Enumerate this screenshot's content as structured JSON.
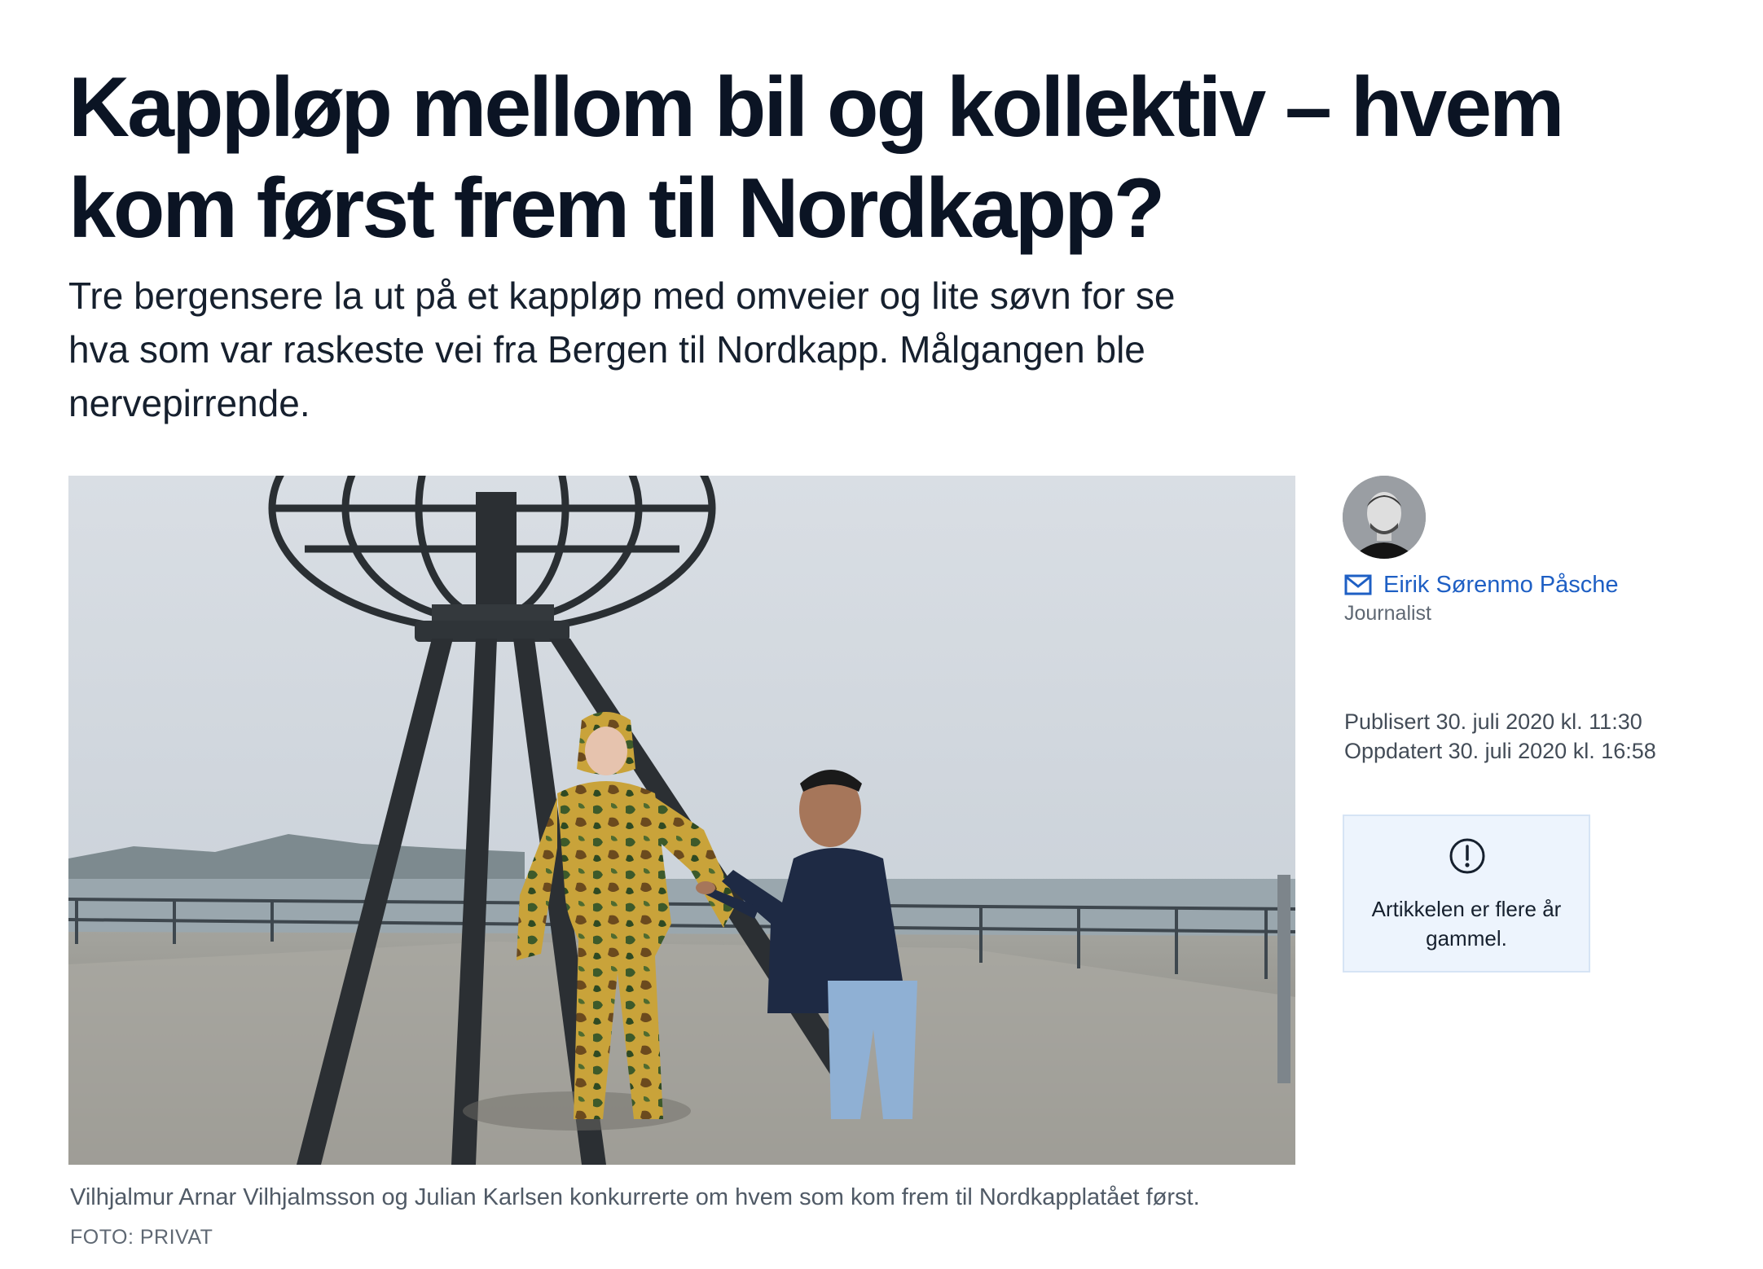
{
  "article": {
    "headline": "Kappløp mellom bil og kollektiv – hvem kom først frem til Nordkapp?",
    "lead": "Tre bergensere la ut på et kappløp med omveier og lite søvn for se hva som var raskeste vei fra Bergen til Nordkapp. Målgangen ble nervepirrende.",
    "image": {
      "caption": "Vilhjalmur Arnar Vilhjalmsson og Julian Karlsen konkurrerte om hvem som kom frem til Nordkapplatået først.",
      "credit": "FOTO: PRIVAT"
    }
  },
  "byline": {
    "author_name": "Eirik Sørenmo Påsche",
    "author_role": "Journalist",
    "contact_icon": "mail-icon",
    "published": "Publisert 30. juli 2020 kl. 11:30",
    "updated": "Oppdatert 30. juli 2020 kl. 16:58"
  },
  "notice": {
    "icon": "exclamation-circle-icon",
    "text": "Artikkelen er flere år gammel."
  },
  "colors": {
    "headline": "#0b1424",
    "link": "#1e5fc4",
    "notice_bg": "#edf4fd",
    "meta": "#5f6873"
  }
}
